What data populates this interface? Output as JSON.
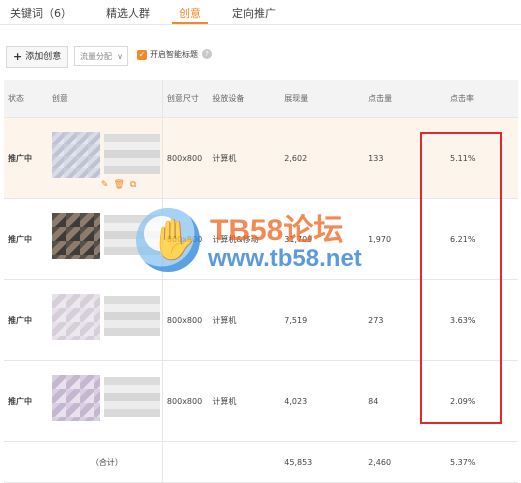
{
  "tabs": [
    {
      "label": "关键词（6）"
    },
    {
      "label": "精选人群"
    },
    {
      "label": "创意"
    },
    {
      "label": "定向推广"
    }
  ],
  "toolbar": {
    "add_label": "添加创意",
    "traffic_select": "流量分配",
    "smart_title_label": "开启智能标题",
    "smart_title_checked": true
  },
  "table": {
    "headers": [
      "状态",
      "创意",
      "创意尺寸",
      "投放设备",
      "展现量",
      "点击量",
      "点击率"
    ],
    "rows": [
      {
        "status": "推广中",
        "size": "800x800",
        "device": "计算机",
        "impressions": "2,602",
        "clicks": "133",
        "ctr": "5.11%"
      },
      {
        "status": "推广中",
        "size": "800x800",
        "device": "计算机&移动",
        "impressions": "31,709",
        "clicks": "1,970",
        "ctr": "6.21%"
      },
      {
        "status": "推广中",
        "size": "800x800",
        "device": "计算机",
        "impressions": "7,519",
        "clicks": "273",
        "ctr": "3.63%"
      },
      {
        "status": "推广中",
        "size": "800x800",
        "device": "计算机",
        "impressions": "4,023",
        "clicks": "84",
        "ctr": "2.09%"
      }
    ],
    "total": {
      "label": "（合计）",
      "impressions": "45,853",
      "clicks": "2,460",
      "ctr": "5.37%"
    }
  },
  "watermark": {
    "title": "TB58论坛",
    "url": "www.tb58.net"
  },
  "colors": {
    "accent": "#f08a24",
    "status": "#58a017",
    "highlight_box": "#e02a2a"
  }
}
